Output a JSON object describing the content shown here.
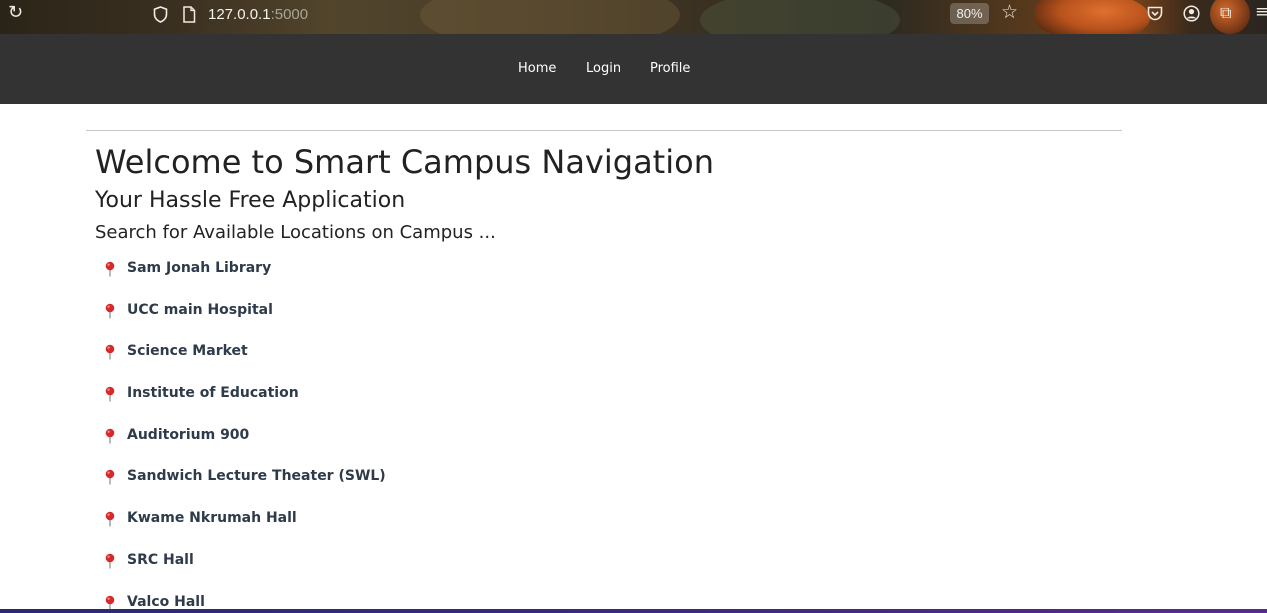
{
  "browser": {
    "url_host": "127.0.0.1",
    "url_port": ":5000",
    "zoom": "80%",
    "icons": [
      "reload-icon",
      "shield-icon",
      "page-icon",
      "bookmark-star-icon",
      "pocket-icon",
      "account-icon",
      "extensions-icon",
      "menu-icon"
    ]
  },
  "nav": {
    "home": "Home",
    "login": "Login",
    "profile": "Profile"
  },
  "main": {
    "title": "Welcome to Smart Campus Navigation",
    "subtitle": "Your Hassle Free Application",
    "search_heading": "Search for Available Locations on Campus ...",
    "locations": [
      "Sam Jonah Library",
      "UCC main Hospital",
      "Science Market",
      "Institute of Education",
      "Auditorium 900",
      "Sandwich Lecture Theater (SWL)",
      "Kwame Nkrumah Hall",
      "SRC Hall",
      "Valco Hall"
    ]
  },
  "colors": {
    "navbar": "#333333",
    "nav_text": "#ffffff",
    "location_text": "#2f3b4a",
    "pin": "#d62a2a"
  }
}
